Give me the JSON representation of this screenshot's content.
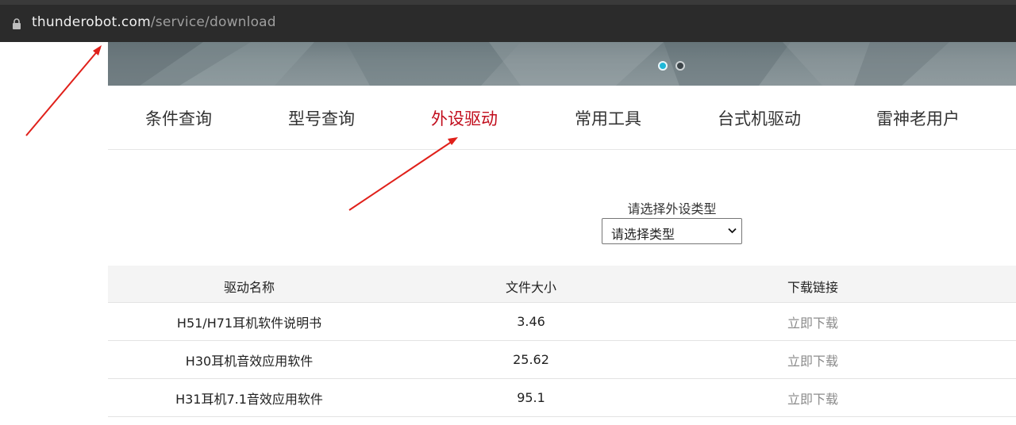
{
  "browser": {
    "url_host": "thunderobot.com",
    "url_path": "/service/download",
    "icon": "lock-icon"
  },
  "banner": {
    "slides": 2,
    "active_slide": 1,
    "active_dot_color": "#1fb8d8"
  },
  "tabs": [
    {
      "label": "条件查询",
      "active": false
    },
    {
      "label": "型号查询",
      "active": false
    },
    {
      "label": "外设驱动",
      "active": true
    },
    {
      "label": "常用工具",
      "active": false
    },
    {
      "label": "台式机驱动",
      "active": false
    },
    {
      "label": "雷神老用户",
      "active": false
    }
  ],
  "filter": {
    "label": "请选择外设类型",
    "selected": "请选择类型",
    "icon": "chevron-down-icon"
  },
  "table": {
    "headers": [
      "驱动名称",
      "文件大小",
      "下载链接"
    ],
    "rows": [
      {
        "name": "H51/H71耳机软件说明书",
        "size": "3.46",
        "link": "立即下载"
      },
      {
        "name": "H30耳机音效应用软件",
        "size": "25.62",
        "link": "立即下载"
      },
      {
        "name": "H31耳机7.1音效应用软件",
        "size": "95.1",
        "link": "立即下载"
      }
    ]
  },
  "colors": {
    "accent": "#c10d1c",
    "link": "#8c8c8c",
    "annotation": "#e0201a"
  }
}
